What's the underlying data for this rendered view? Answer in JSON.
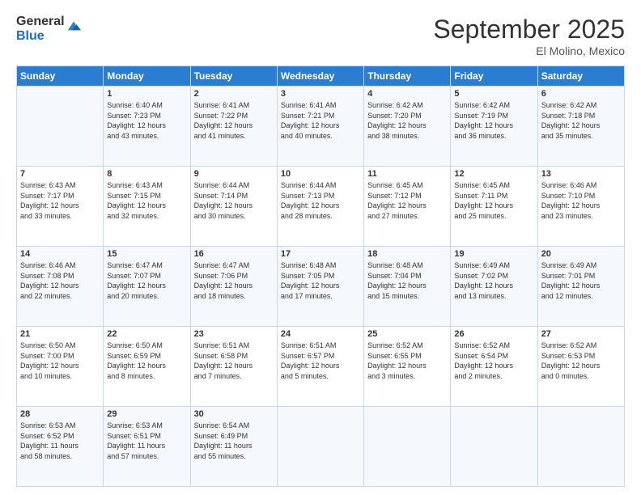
{
  "logo": {
    "general": "General",
    "blue": "Blue"
  },
  "header": {
    "month": "September 2025",
    "location": "El Molino, Mexico"
  },
  "weekdays": [
    "Sunday",
    "Monday",
    "Tuesday",
    "Wednesday",
    "Thursday",
    "Friday",
    "Saturday"
  ],
  "weeks": [
    [
      {
        "day": "",
        "info": ""
      },
      {
        "day": "1",
        "info": "Sunrise: 6:40 AM\nSunset: 7:23 PM\nDaylight: 12 hours\nand 43 minutes."
      },
      {
        "day": "2",
        "info": "Sunrise: 6:41 AM\nSunset: 7:22 PM\nDaylight: 12 hours\nand 41 minutes."
      },
      {
        "day": "3",
        "info": "Sunrise: 6:41 AM\nSunset: 7:21 PM\nDaylight: 12 hours\nand 40 minutes."
      },
      {
        "day": "4",
        "info": "Sunrise: 6:42 AM\nSunset: 7:20 PM\nDaylight: 12 hours\nand 38 minutes."
      },
      {
        "day": "5",
        "info": "Sunrise: 6:42 AM\nSunset: 7:19 PM\nDaylight: 12 hours\nand 36 minutes."
      },
      {
        "day": "6",
        "info": "Sunrise: 6:42 AM\nSunset: 7:18 PM\nDaylight: 12 hours\nand 35 minutes."
      }
    ],
    [
      {
        "day": "7",
        "info": "Sunrise: 6:43 AM\nSunset: 7:17 PM\nDaylight: 12 hours\nand 33 minutes."
      },
      {
        "day": "8",
        "info": "Sunrise: 6:43 AM\nSunset: 7:15 PM\nDaylight: 12 hours\nand 32 minutes."
      },
      {
        "day": "9",
        "info": "Sunrise: 6:44 AM\nSunset: 7:14 PM\nDaylight: 12 hours\nand 30 minutes."
      },
      {
        "day": "10",
        "info": "Sunrise: 6:44 AM\nSunset: 7:13 PM\nDaylight: 12 hours\nand 28 minutes."
      },
      {
        "day": "11",
        "info": "Sunrise: 6:45 AM\nSunset: 7:12 PM\nDaylight: 12 hours\nand 27 minutes."
      },
      {
        "day": "12",
        "info": "Sunrise: 6:45 AM\nSunset: 7:11 PM\nDaylight: 12 hours\nand 25 minutes."
      },
      {
        "day": "13",
        "info": "Sunrise: 6:46 AM\nSunset: 7:10 PM\nDaylight: 12 hours\nand 23 minutes."
      }
    ],
    [
      {
        "day": "14",
        "info": "Sunrise: 6:46 AM\nSunset: 7:08 PM\nDaylight: 12 hours\nand 22 minutes."
      },
      {
        "day": "15",
        "info": "Sunrise: 6:47 AM\nSunset: 7:07 PM\nDaylight: 12 hours\nand 20 minutes."
      },
      {
        "day": "16",
        "info": "Sunrise: 6:47 AM\nSunset: 7:06 PM\nDaylight: 12 hours\nand 18 minutes."
      },
      {
        "day": "17",
        "info": "Sunrise: 6:48 AM\nSunset: 7:05 PM\nDaylight: 12 hours\nand 17 minutes."
      },
      {
        "day": "18",
        "info": "Sunrise: 6:48 AM\nSunset: 7:04 PM\nDaylight: 12 hours\nand 15 minutes."
      },
      {
        "day": "19",
        "info": "Sunrise: 6:49 AM\nSunset: 7:02 PM\nDaylight: 12 hours\nand 13 minutes."
      },
      {
        "day": "20",
        "info": "Sunrise: 6:49 AM\nSunset: 7:01 PM\nDaylight: 12 hours\nand 12 minutes."
      }
    ],
    [
      {
        "day": "21",
        "info": "Sunrise: 6:50 AM\nSunset: 7:00 PM\nDaylight: 12 hours\nand 10 minutes."
      },
      {
        "day": "22",
        "info": "Sunrise: 6:50 AM\nSunset: 6:59 PM\nDaylight: 12 hours\nand 8 minutes."
      },
      {
        "day": "23",
        "info": "Sunrise: 6:51 AM\nSunset: 6:58 PM\nDaylight: 12 hours\nand 7 minutes."
      },
      {
        "day": "24",
        "info": "Sunrise: 6:51 AM\nSunset: 6:57 PM\nDaylight: 12 hours\nand 5 minutes."
      },
      {
        "day": "25",
        "info": "Sunrise: 6:52 AM\nSunset: 6:55 PM\nDaylight: 12 hours\nand 3 minutes."
      },
      {
        "day": "26",
        "info": "Sunrise: 6:52 AM\nSunset: 6:54 PM\nDaylight: 12 hours\nand 2 minutes."
      },
      {
        "day": "27",
        "info": "Sunrise: 6:52 AM\nSunset: 6:53 PM\nDaylight: 12 hours\nand 0 minutes."
      }
    ],
    [
      {
        "day": "28",
        "info": "Sunrise: 6:53 AM\nSunset: 6:52 PM\nDaylight: 11 hours\nand 58 minutes."
      },
      {
        "day": "29",
        "info": "Sunrise: 6:53 AM\nSunset: 6:51 PM\nDaylight: 11 hours\nand 57 minutes."
      },
      {
        "day": "30",
        "info": "Sunrise: 6:54 AM\nSunset: 6:49 PM\nDaylight: 11 hours\nand 55 minutes."
      },
      {
        "day": "",
        "info": ""
      },
      {
        "day": "",
        "info": ""
      },
      {
        "day": "",
        "info": ""
      },
      {
        "day": "",
        "info": ""
      }
    ]
  ]
}
